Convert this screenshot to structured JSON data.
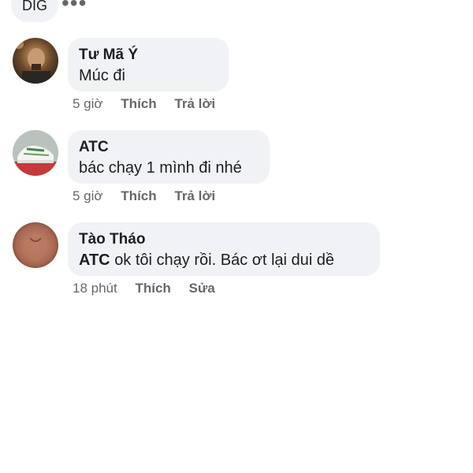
{
  "header": {
    "pill_label": "DIG",
    "more_label": "•••"
  },
  "comments": [
    {
      "author": "Tư Mã Ý",
      "text": "Múc đi",
      "time": "5 giờ",
      "actions": [
        "Thích",
        "Trả lời"
      ]
    },
    {
      "author": "ATC",
      "text": "bác chạy 1 mình đi nhé",
      "time": "5 giờ",
      "actions": [
        "Thích",
        "Trả lời"
      ]
    },
    {
      "author": "Tào Tháo",
      "mention": "ATC",
      "text": "ok tôi chạy rồi. Bác ơt lại dui dề",
      "time": "18 phút",
      "actions": [
        "Thích",
        "Sửa"
      ]
    }
  ],
  "colors": {
    "bubble": "#f0f2f5",
    "meta_text": "#65676b",
    "body_text": "#1c1e21"
  }
}
